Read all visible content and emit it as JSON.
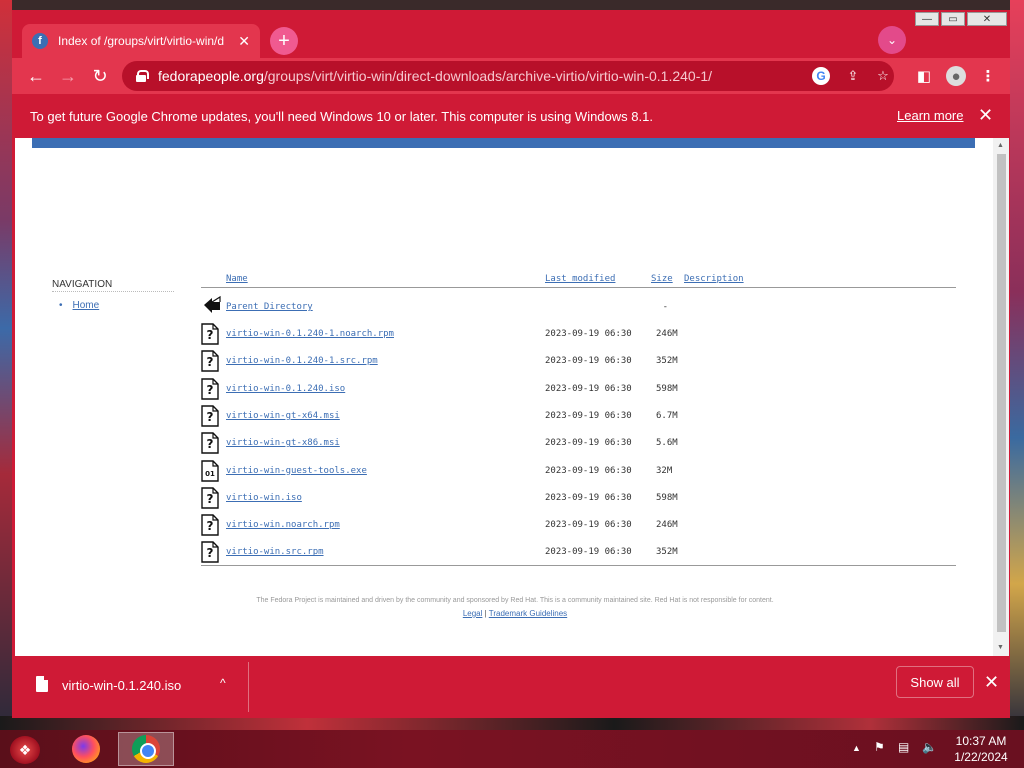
{
  "window": {
    "tab_title": "Index of /groups/virt/virtio-win/d",
    "tab_favicon": "f",
    "new_tab": "+",
    "tab_search": "⌄",
    "controls": {
      "minimize": "—",
      "maximize": "▭",
      "close": "✕"
    }
  },
  "toolbar": {
    "back": "←",
    "forward": "→",
    "reload": "↻",
    "url_host": "fedorapeople.org",
    "url_path": "/groups/virt/virtio-win/direct-downloads/archive-virtio/virtio-win-0.1.240-1/",
    "google_icon": "G",
    "share_icon": "⇪",
    "star_icon": "☆",
    "sidepanel_icon": "◧",
    "profile_icon": "●",
    "menu_icon": "⋮"
  },
  "infobar": {
    "message": "To get future Google Chrome updates, you'll need Windows 10 or later. This computer is using Windows 8.1.",
    "learn_more": "Learn more",
    "close": "✕"
  },
  "page": {
    "nav_heading": "NAVIGATION",
    "nav_home": "Home",
    "headers": {
      "name": "Name",
      "last_modified": "Last modified",
      "size": "Size",
      "description": "Description"
    },
    "parent": {
      "name": "Parent Directory",
      "size": "-"
    },
    "files": [
      {
        "name": "virtio-win-0.1.240-1.noarch.rpm",
        "date": "2023-09-19 06:30",
        "size": "246M",
        "icon": "unknown-file-icon"
      },
      {
        "name": "virtio-win-0.1.240-1.src.rpm",
        "date": "2023-09-19 06:30",
        "size": "352M",
        "icon": "unknown-file-icon"
      },
      {
        "name": "virtio-win-0.1.240.iso",
        "date": "2023-09-19 06:30",
        "size": "598M",
        "icon": "unknown-file-icon"
      },
      {
        "name": "virtio-win-gt-x64.msi",
        "date": "2023-09-19 06:30",
        "size": "6.7M",
        "icon": "unknown-file-icon"
      },
      {
        "name": "virtio-win-gt-x86.msi",
        "date": "2023-09-19 06:30",
        "size": "5.6M",
        "icon": "unknown-file-icon"
      },
      {
        "name": "virtio-win-guest-tools.exe",
        "date": "2023-09-19 06:30",
        "size": "32M",
        "icon": "binary-file-icon"
      },
      {
        "name": "virtio-win.iso",
        "date": "2023-09-19 06:30",
        "size": "598M",
        "icon": "unknown-file-icon"
      },
      {
        "name": "virtio-win.noarch.rpm",
        "date": "2023-09-19 06:30",
        "size": "246M",
        "icon": "unknown-file-icon"
      },
      {
        "name": "virtio-win.src.rpm",
        "date": "2023-09-19 06:30",
        "size": "352M",
        "icon": "unknown-file-icon"
      }
    ],
    "footer_text": "The Fedora Project is maintained and driven by the community and sponsored by Red Hat. This is a community maintained site. Red Hat is not responsible for content.",
    "footer_legal": "Legal",
    "footer_sep": "|",
    "footer_trademark": "Trademark Guidelines"
  },
  "download_bar": {
    "file_name": "virtio-win-0.1.240.iso",
    "chevron": "^",
    "show_all": "Show all",
    "close": "✕"
  },
  "taskbar": {
    "start_icon": "❖",
    "tray_up": "▲",
    "tray_flag": "⚑",
    "tray_network": "▤",
    "tray_volume": "🔈",
    "time": "10:37 AM",
    "date": "1/22/2024"
  },
  "colors": {
    "chrome_red": "#cf1a36",
    "link_blue": "#3c6eb4"
  }
}
